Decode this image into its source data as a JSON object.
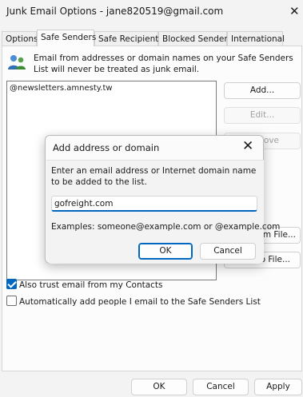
{
  "window": {
    "title": "Junk Email Options - jane820519@gmail.com",
    "close_glyph": "✕"
  },
  "tabs": [
    {
      "label": "Options",
      "active": false
    },
    {
      "label": "Safe Senders",
      "active": true
    },
    {
      "label": "Safe Recipients",
      "active": false
    },
    {
      "label": "Blocked Senders",
      "active": false
    },
    {
      "label": "International",
      "active": false
    }
  ],
  "safe_senders": {
    "icon": "people-icon",
    "description": "Email from addresses or domain names on your Safe Senders List will never be treated as junk email.",
    "list": [
      "@newsletters.amnesty.tw"
    ],
    "buttons": {
      "add": "Add...",
      "edit": "Edit...",
      "remove_partial": "nove",
      "import_partial": "rom File...",
      "export_partial": "to File..."
    },
    "trust_contacts": {
      "label": "Also trust email from my Contacts",
      "checked": true
    },
    "auto_add": {
      "label": "Automatically add people I email to the Safe Senders List",
      "checked": false
    }
  },
  "footer": {
    "ok": "OK",
    "cancel": "Cancel",
    "apply": "Apply"
  },
  "dialog": {
    "title": "Add address or domain",
    "close_glyph": "✕",
    "prompt": "Enter an email address or Internet domain name to be added to the list.",
    "input_value": "gofreight.com",
    "examples": "Examples: someone@example.com or @example.com",
    "ok": "OK",
    "cancel": "Cancel"
  },
  "colors": {
    "accent": "#0067c0"
  }
}
